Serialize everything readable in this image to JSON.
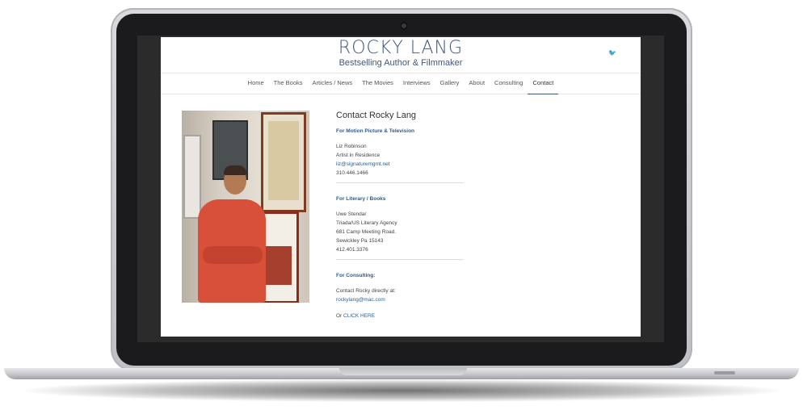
{
  "site": {
    "title": "ROCKY LANG",
    "subtitle": "Bestselling Author & Filmmaker",
    "social_icon": "twitter-icon",
    "social_glyph": "🐦"
  },
  "nav": {
    "items": [
      {
        "label": "Home"
      },
      {
        "label": "The Books"
      },
      {
        "label": "Articles / News"
      },
      {
        "label": "The Movies"
      },
      {
        "label": "Interviews"
      },
      {
        "label": "Gallery"
      },
      {
        "label": "About"
      },
      {
        "label": "Consulting"
      },
      {
        "label": "Contact",
        "active": true
      }
    ]
  },
  "contact": {
    "heading": "Contact Rocky Lang",
    "motion": {
      "title": "For Motion Picture & Television",
      "name": "Liz Robinson",
      "role": "Artist in Residence",
      "email": "liz@signaturemgmt.net",
      "phone": "310.446.1466"
    },
    "literary": {
      "title": "For Literary / Books",
      "name": "Uwe Stendar",
      "agency": "Triada/US Literary Agency",
      "address1": "681 Camp Meeting Road.",
      "address2": "Sewickley Pa 15143",
      "phone": "412.401.3376"
    },
    "consulting": {
      "title": "For Consulting:",
      "intro": "Contact Rocky directly at:",
      "email": "rockylang@mac.com",
      "or_label": "Or",
      "click_label": "CLICK HERE"
    }
  },
  "colors": {
    "brand": "#42587c",
    "link": "#2e5b8c"
  }
}
